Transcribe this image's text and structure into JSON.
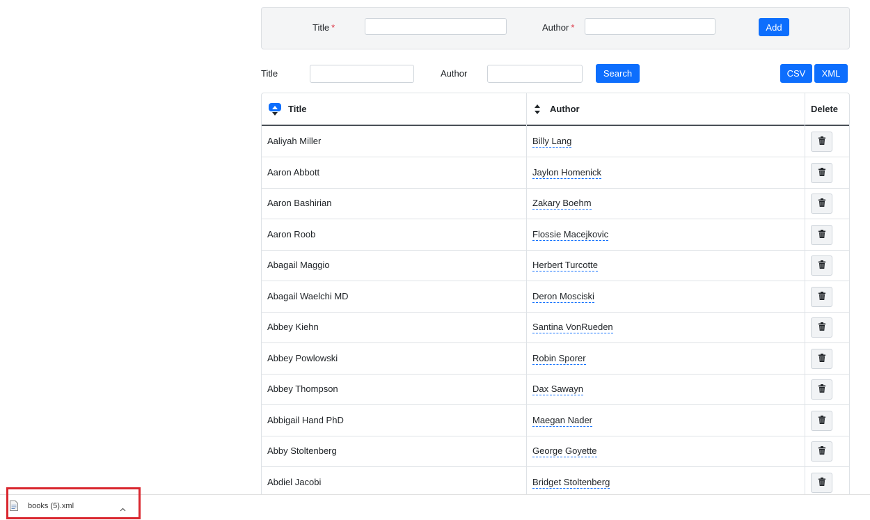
{
  "add_form": {
    "title_label": "Title",
    "author_label": "Author",
    "required_mark": "*",
    "title_value": "",
    "author_value": "",
    "add_label": "Add"
  },
  "search_form": {
    "title_label": "Title",
    "author_label": "Author",
    "title_value": "",
    "author_value": "",
    "search_label": "Search",
    "csv_label": "CSV",
    "xml_label": "XML"
  },
  "table": {
    "headers": {
      "title": "Title",
      "author": "Author",
      "delete": "Delete"
    },
    "sort": {
      "column": "title",
      "direction": "ascending"
    },
    "rows": [
      {
        "title": "Aaliyah Miller",
        "author": "Billy Lang"
      },
      {
        "title": "Aaron Abbott",
        "author": "Jaylon Homenick"
      },
      {
        "title": "Aaron Bashirian",
        "author": "Zakary Boehm"
      },
      {
        "title": "Aaron Roob",
        "author": "Flossie Macejkovic"
      },
      {
        "title": "Abagail Maggio",
        "author": "Herbert Turcotte"
      },
      {
        "title": "Abagail Waelchi MD",
        "author": "Deron Mosciski"
      },
      {
        "title": "Abbey Kiehn",
        "author": "Santina VonRueden"
      },
      {
        "title": "Abbey Powlowski",
        "author": "Robin Sporer"
      },
      {
        "title": "Abbey Thompson",
        "author": "Dax Sawayn"
      },
      {
        "title": "Abbigail Hand PhD",
        "author": "Maegan Nader"
      },
      {
        "title": "Abby Stoltenberg",
        "author": "George Goyette"
      },
      {
        "title": "Abdiel Jacobi",
        "author": "Bridget Stoltenberg"
      }
    ]
  },
  "download_bar": {
    "file_name": "books (5).xml",
    "file_icon": "xml-file-icon",
    "menu_icon": "chevron-up-icon"
  },
  "colors": {
    "primary": "#0d6efd",
    "required": "#dc3545",
    "highlight": "#d9262e"
  }
}
